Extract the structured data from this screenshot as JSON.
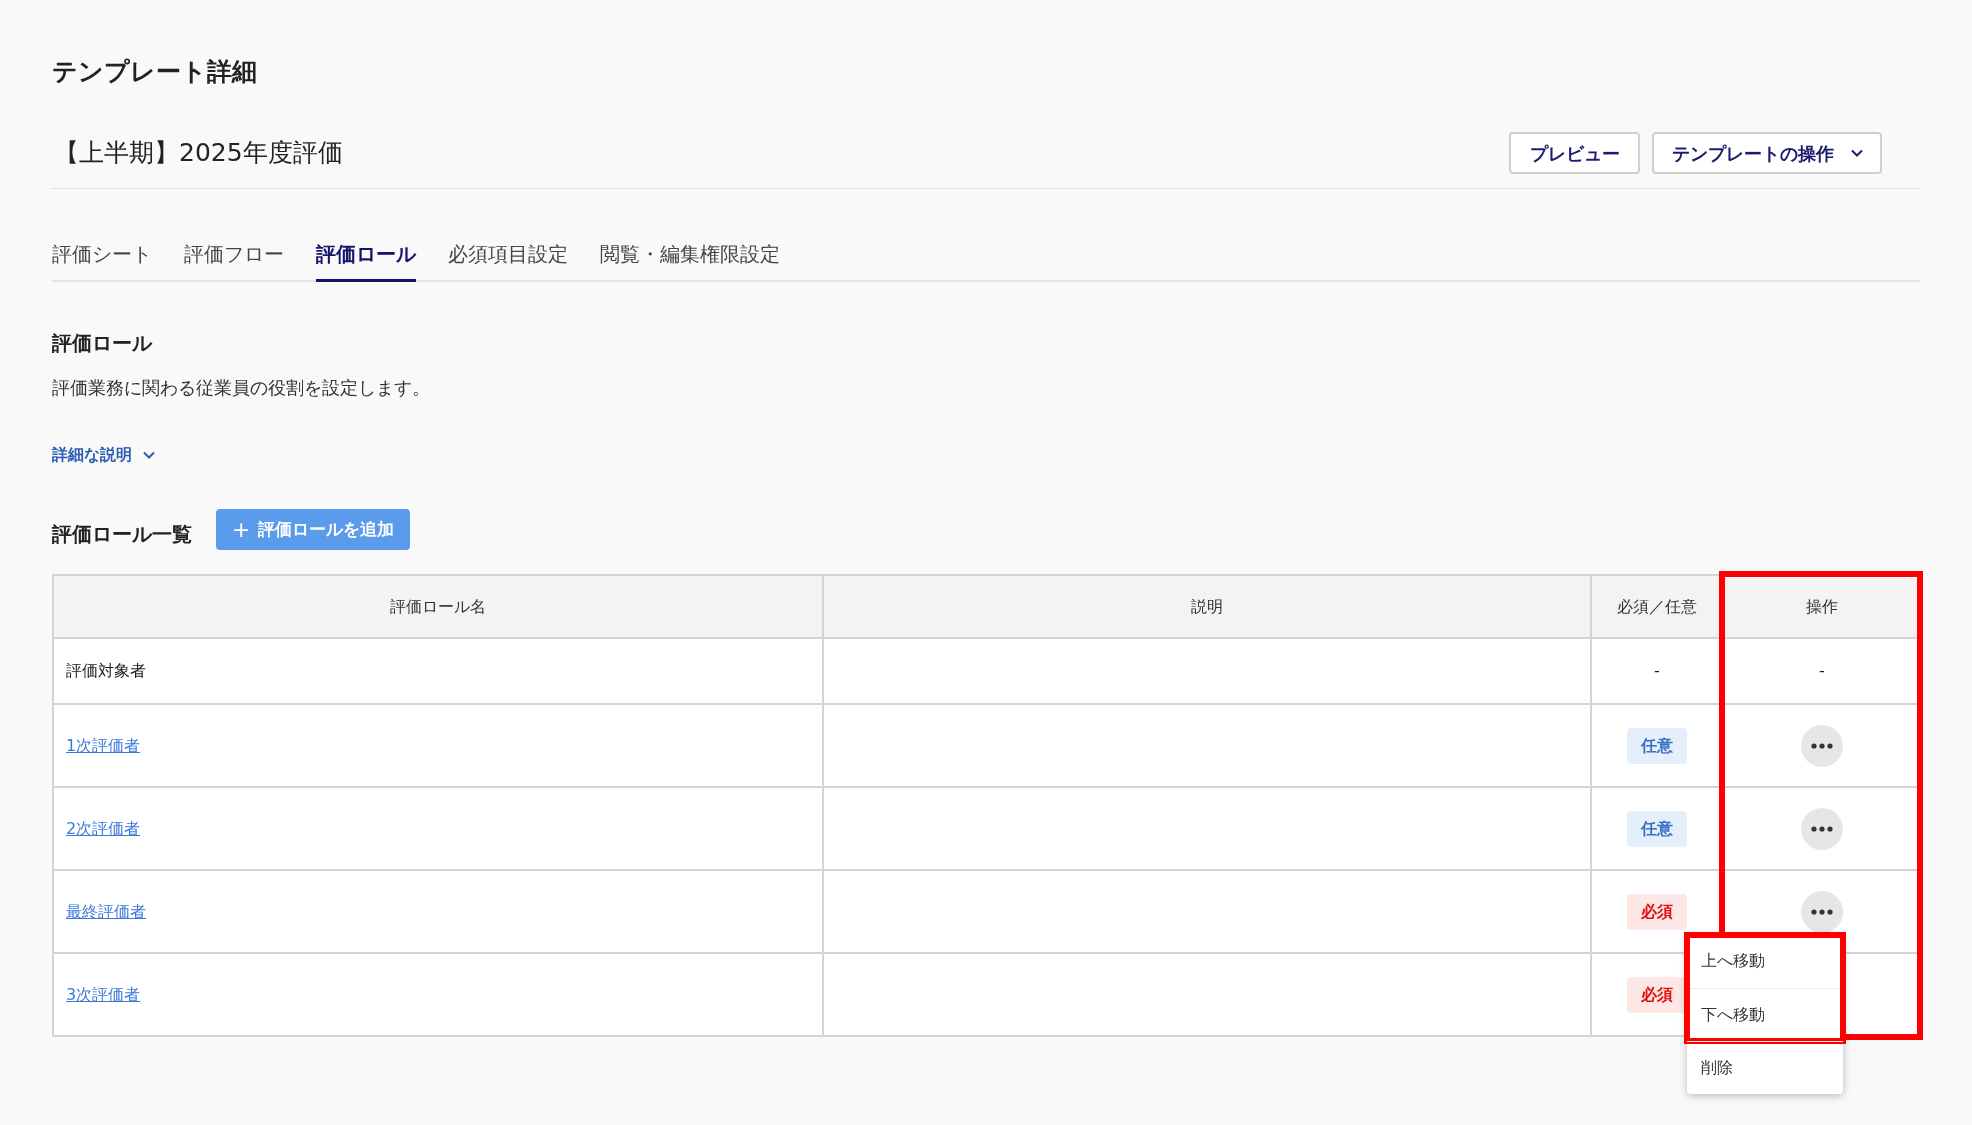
{
  "page_title": "テンプレート詳細",
  "template_name": "【上半期】2025年度評価",
  "header_buttons": [
    {
      "label": "プレビュー",
      "kind": "plain"
    },
    {
      "label": "テンプレートの操作",
      "kind": "dropdown"
    }
  ],
  "tabs": [
    {
      "label": "評価シート",
      "selected": false
    },
    {
      "label": "評価フロー",
      "selected": false
    },
    {
      "label": "評価ロール",
      "selected": true
    },
    {
      "label": "必須項目設定",
      "selected": false
    },
    {
      "label": "閲覧・編集権限設定",
      "selected": false
    }
  ],
  "section": {
    "title": "評価ロール",
    "description": "評価業務に関わる従業員の役割を設定します。",
    "details_toggle": {
      "label": "詳細な説明",
      "expanded": false
    }
  },
  "list_title": "評価ロール一覧",
  "add_button": {
    "icon": "+",
    "label": "評価ロールを追加"
  },
  "table": {
    "columns": [
      {
        "label": "評価ロール名",
        "highlighted": false
      },
      {
        "label": "説明",
        "highlighted": false
      },
      {
        "label": "必須／任意",
        "highlighted": false
      },
      {
        "label": "操作",
        "highlighted": true
      }
    ],
    "rows": [
      {
        "name": "評価対象者",
        "link": false,
        "requirement": {
          "kind": "dash",
          "label": "-"
        },
        "action": {
          "kind": "dash",
          "label": "-"
        }
      },
      {
        "name": "1次評価者",
        "link": true,
        "requirement": {
          "kind": "optional",
          "label": "任意"
        },
        "action": {
          "kind": "menu"
        }
      },
      {
        "name": "2次評価者",
        "link": true,
        "requirement": {
          "kind": "optional",
          "label": "任意"
        },
        "action": {
          "kind": "menu"
        }
      },
      {
        "name": "最終評価者",
        "link": true,
        "requirement": {
          "kind": "required",
          "label": "必須"
        },
        "action": {
          "kind": "menu",
          "menu_open": true
        }
      },
      {
        "name": "3次評価者",
        "link": true,
        "requirement": {
          "kind": "required",
          "label": "必須"
        }
      }
    ]
  },
  "menu": {
    "items": [
      {
        "label": "上へ移動",
        "highlighted": true
      },
      {
        "label": "下へ移動",
        "highlighted": true
      },
      {
        "label": "削除",
        "highlighted": false
      }
    ]
  }
}
